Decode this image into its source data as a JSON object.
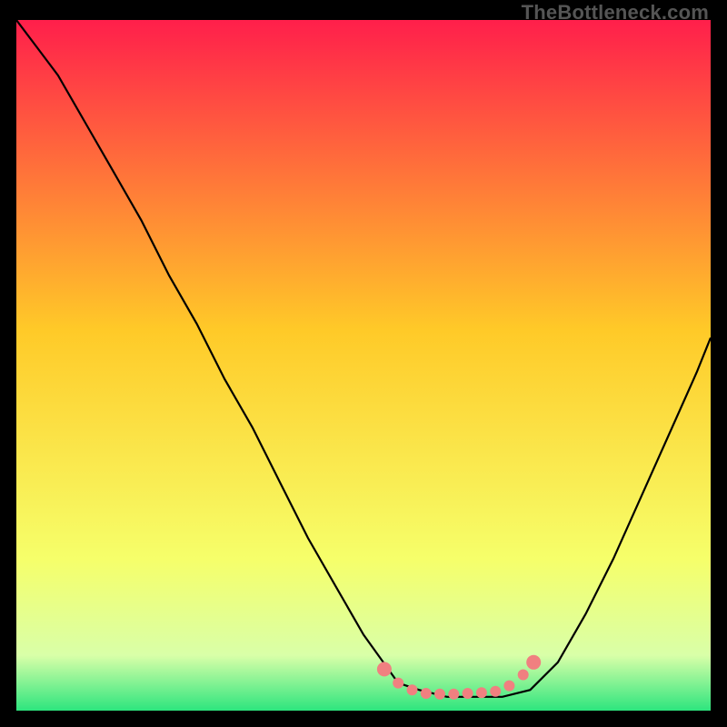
{
  "watermark": "TheBottleneck.com",
  "chart_data": {
    "type": "line",
    "title": "",
    "xlabel": "",
    "ylabel": "",
    "xlim": [
      0,
      100
    ],
    "ylim": [
      0,
      100
    ],
    "grid": false,
    "legend": false,
    "background_gradient": {
      "top_color": "#ff1f4b",
      "mid_color": "#ffd92a",
      "bottom_color": "#2de57e"
    },
    "series": [
      {
        "name": "bottleneck-curve",
        "x": [
          0,
          3,
          6,
          10,
          14,
          18,
          22,
          26,
          30,
          34,
          38,
          42,
          46,
          50,
          55,
          58,
          62,
          66,
          70,
          74,
          78,
          82,
          86,
          90,
          94,
          98,
          100
        ],
        "y": [
          100,
          96,
          92,
          85,
          78,
          71,
          63,
          56,
          48,
          41,
          33,
          25,
          18,
          11,
          4,
          3,
          2,
          2,
          2,
          3,
          7,
          14,
          22,
          31,
          40,
          49,
          54
        ]
      }
    ],
    "markers": {
      "name": "highlight-dots",
      "color": "#f08080",
      "x": [
        53,
        55,
        57,
        59,
        61,
        63,
        65,
        67,
        69,
        71,
        73,
        74.5
      ],
      "y": [
        6,
        4,
        3,
        2.5,
        2.4,
        2.4,
        2.5,
        2.6,
        2.8,
        3.6,
        5.2,
        7
      ]
    }
  }
}
